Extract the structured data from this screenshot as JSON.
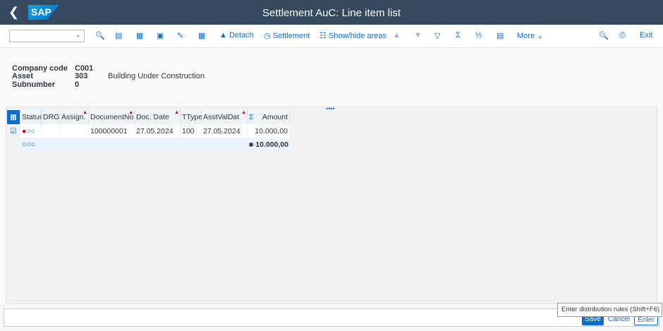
{
  "header": {
    "title": "Settlement AuC: Line item list",
    "logo": "SAP",
    "back_icon": "back-icon"
  },
  "toolbar": {
    "select_value": "",
    "detach": "Detach",
    "settlement": "Settlement",
    "show_hide": "Show/hide areas",
    "more": "More",
    "exit": "Exit",
    "sum": "Σ",
    "subtotal": "½"
  },
  "info": {
    "company_code_label": "Company code",
    "company_code": "C001",
    "asset_label": "Asset",
    "asset": "303",
    "asset_desc": "Building Under Construction",
    "subnumber_label": "Subnumber",
    "subnumber": "0"
  },
  "table": {
    "columns": [
      "Status",
      "DRG",
      "Assign.",
      "DocumentNo",
      "Doc. Date",
      "TType",
      "AsstValDat",
      "Amount"
    ],
    "rows": [
      {
        "status": "●○○",
        "drg": "",
        "assign": "",
        "docno": "100000001",
        "docdate": "27.05.2024",
        "ttype": "100",
        "asstvaldat": "27.05.2024",
        "amount": "10.000,00"
      }
    ],
    "total": {
      "status": "○○○",
      "amount": "■ 10.000,00"
    }
  },
  "footer": {
    "save": "Save",
    "cancel": "Cancel",
    "enter": "Enter",
    "tooltip": "Enter distribution rules    (Shift+F6)"
  },
  "colors": {
    "header": "#354a5f",
    "accent": "#0a6ed1"
  }
}
